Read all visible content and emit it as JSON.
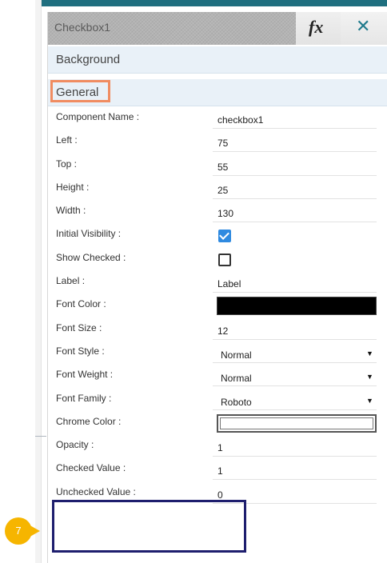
{
  "panel": {
    "title": "Checkbox1",
    "fx_label": "fx",
    "close_label": "✕"
  },
  "sections": {
    "background": "Background",
    "general": "General"
  },
  "properties": [
    {
      "label": "Component Name :",
      "value": "checkbox1",
      "kind": "text"
    },
    {
      "label": "Left :",
      "value": "75",
      "kind": "text"
    },
    {
      "label": "Top :",
      "value": "55",
      "kind": "text"
    },
    {
      "label": "Height :",
      "value": "25",
      "kind": "text"
    },
    {
      "label": "Width :",
      "value": "130",
      "kind": "text"
    },
    {
      "label": "Initial Visibility :",
      "checked": true,
      "kind": "checkbox"
    },
    {
      "label": "Show Checked :",
      "checked": false,
      "kind": "checkbox"
    },
    {
      "label": "Label :",
      "value": "Label",
      "kind": "text"
    },
    {
      "label": "Font Color :",
      "color": "#000000",
      "kind": "color"
    },
    {
      "label": "Font Size :",
      "value": "12",
      "kind": "text"
    },
    {
      "label": "Font Style :",
      "value": "Normal",
      "kind": "select"
    },
    {
      "label": "Font Weight :",
      "value": "Normal",
      "kind": "select"
    },
    {
      "label": "Font Family :",
      "value": "Roboto",
      "kind": "select"
    },
    {
      "label": "Chrome Color :",
      "color": "#ffffff",
      "kind": "color"
    },
    {
      "label": "Opacity :",
      "value": "1",
      "kind": "text"
    },
    {
      "label": "Checked Value :",
      "value": "1",
      "kind": "text"
    },
    {
      "label": "Unchecked Value :",
      "value": "0",
      "kind": "text"
    }
  ],
  "callout": {
    "step_number": "7",
    "color": "#f6b500",
    "box_color": "#1e1e6e"
  },
  "colors": {
    "highlight": "#f08c61",
    "checkbox_on": "#2f8ae0",
    "section_bg": "#e9f1f8"
  }
}
